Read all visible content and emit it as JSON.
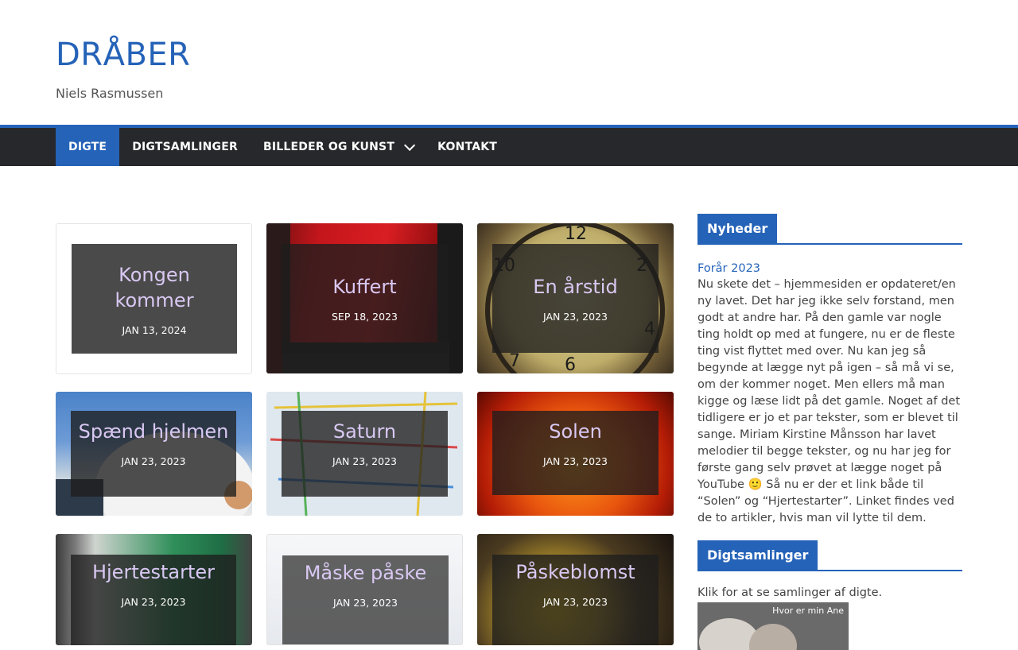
{
  "site": {
    "title": "DRÅBER",
    "description": "Niels Rasmussen"
  },
  "nav": {
    "items": [
      {
        "label": "DIGTE",
        "active": true
      },
      {
        "label": "DIGTSAMLINGER",
        "active": false
      },
      {
        "label": "BILLEDER OG KUNST",
        "active": false,
        "has_dropdown": true
      },
      {
        "label": "KONTAKT",
        "active": false
      }
    ]
  },
  "posts": [
    {
      "title": "Kongen kommer",
      "date": "JAN 13, 2024"
    },
    {
      "title": "Kuffert",
      "date": "SEP 18, 2023"
    },
    {
      "title": "En årstid",
      "date": "JAN 23, 2023"
    },
    {
      "title": "Spænd hjelmen",
      "date": "JAN 23, 2023"
    },
    {
      "title": "Saturn",
      "date": "JAN 23, 2023"
    },
    {
      "title": "Solen",
      "date": "JAN 23, 2023"
    },
    {
      "title": "Hjertestarter",
      "date": "JAN 23, 2023"
    },
    {
      "title": "Måske påske",
      "date": "JAN 23, 2023"
    },
    {
      "title": "Påskeblomst",
      "date": "JAN 23, 2023"
    }
  ],
  "sidebar": {
    "news": {
      "heading": "Nyheder",
      "post_title": "Forår 2023",
      "post_text": "Nu skete det – hjemmesiden er opdateret/en ny lavet. Det har jeg ikke selv forstand, men godt at andre har. På den gamle var nogle ting holdt op med at fungere, nu er de fleste ting vist flyttet med over. Nu kan jeg så begynde at lægge nyt på igen – så må vi se, om der kommer noget. Men ellers må man kigge og læse lidt på det gamle. Noget af det tidligere er jo et par tekster, som er blevet til sange. Miriam Kirstine Månsson har lavet melodier til begge tekster, og nu har jeg for første gang selv prøvet at lægge noget på YouTube 🙂 Så nu er der et link både til “Solen” og “Hjertestarter”. Linket findes ved de to artikler, hvis man vil lytte til dem."
    },
    "collections": {
      "heading": "Digtsamlinger",
      "intro": "Klik for at se samlinger af digte.",
      "thumb_caption": "Hvor er min Ane"
    }
  },
  "colors": {
    "accent": "#2563b8",
    "nav_bg": "#27282b",
    "card_title": "#d9c8f2"
  }
}
